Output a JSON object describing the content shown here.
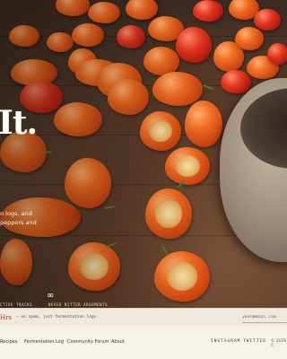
{
  "hero": {
    "title": "It.",
    "line1": "n logs, and",
    "line2": "peppers and"
  },
  "stats": {
    "left_label": "CTIVE TRACKS",
    "right_label": "NEVER BITTER ARGUMENTS",
    "value": "∞"
  },
  "signup": {
    "brand": "Hrs",
    "note": "— no spam, just fermentation logs",
    "email_placeholder": "your@email.com"
  },
  "footer": {
    "links": [
      "Recipes",
      "Fermentation Log",
      "Community Forum",
      "About"
    ],
    "social": [
      "INSTAGRAM",
      "TWITTER"
    ],
    "copyright": "© 2026 C"
  },
  "colors": {
    "accent": "#c23a1e",
    "footer_bg": "#f6f2ea",
    "signup_bg": "#efe8dc"
  }
}
